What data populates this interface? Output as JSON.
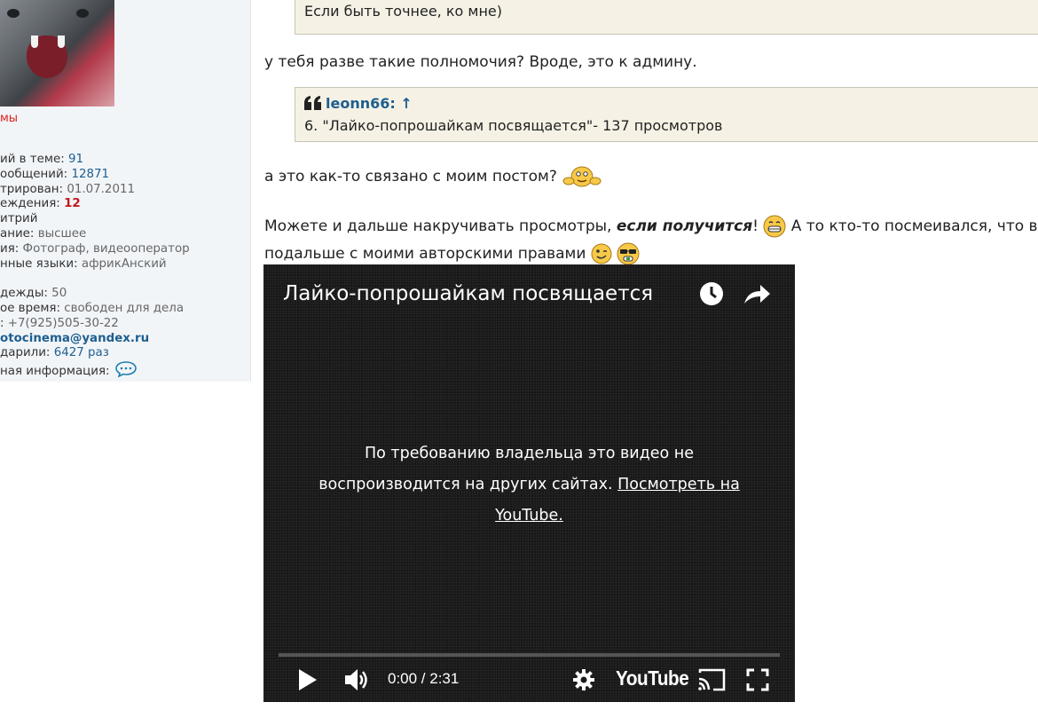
{
  "profile": {
    "username": "мы",
    "stats": [
      {
        "label": "ий в теме:",
        "value": "91",
        "style": "val"
      },
      {
        "label": "ообщений:",
        "value": "12871",
        "style": "val"
      },
      {
        "label": "трирован:",
        "value": "01.07.2011",
        "style": "muted"
      },
      {
        "label": "еждения:",
        "value": "12",
        "style": "red"
      },
      {
        "label": "итрий",
        "value": "",
        "style": "muted"
      },
      {
        "label": "ание:",
        "value": "высшее",
        "style": "muted"
      },
      {
        "label": "ия:",
        "value": "Фотограф, видеооператор",
        "style": "muted"
      },
      {
        "label": "нные языки:",
        "value": "африкАнский",
        "style": "muted"
      },
      {
        "label": "",
        "value": "",
        "style": "muted"
      },
      {
        "label": "дежды:",
        "value": "50",
        "style": "muted"
      },
      {
        "label": "ое время:",
        "value": "свободен для дела",
        "style": "muted"
      },
      {
        "label": ":",
        "value": "+7(925)505-30-22",
        "style": "muted"
      },
      {
        "label": "",
        "value": "otocinema@yandex.ru",
        "style": "bold"
      },
      {
        "label": "дарили:",
        "value": "6427 раз",
        "style": "val"
      },
      {
        "label": "ная информация:",
        "value": "",
        "style": "chat"
      }
    ]
  },
  "post": {
    "quote1": "Если быть точнее, ко мне)",
    "line1": "у тебя разве такие полномочия? Вроде, это к админу.",
    "quote2": {
      "author": "leonn66:",
      "arrow": "↑",
      "text": "6. \"Лайко-попрошайкам посвящается\"- 137 просмотров"
    },
    "line2": "а это как-то связано с моим постом?",
    "line3_prefix": "Можете и дальше накручивать просмотры, ",
    "line3_emph": "если получится",
    "line3_suffix": "! ",
    "line3_rest": " А то кто-то посмеивался, что в",
    "line4": "подальше с моими авторскими правами "
  },
  "video": {
    "title": "Лайко-попрошайкам посвящается",
    "message": "По требованию владельца это видео не воспроизводится на других сайтах.",
    "link": "Посмотреть на YouTube.",
    "time": "0:00 / 2:31",
    "logo": "YouTube",
    "progress": 0
  },
  "icons": [
    "watch-later-icon",
    "share-icon",
    "play-icon",
    "volume-icon",
    "settings-icon",
    "cast-icon",
    "fullscreen-icon",
    "quote-icon",
    "chat-bubble-icon"
  ],
  "colors": {
    "link": "#1e5f8f",
    "quote_bg": "#f5f2e5",
    "username": "#e0201f"
  }
}
